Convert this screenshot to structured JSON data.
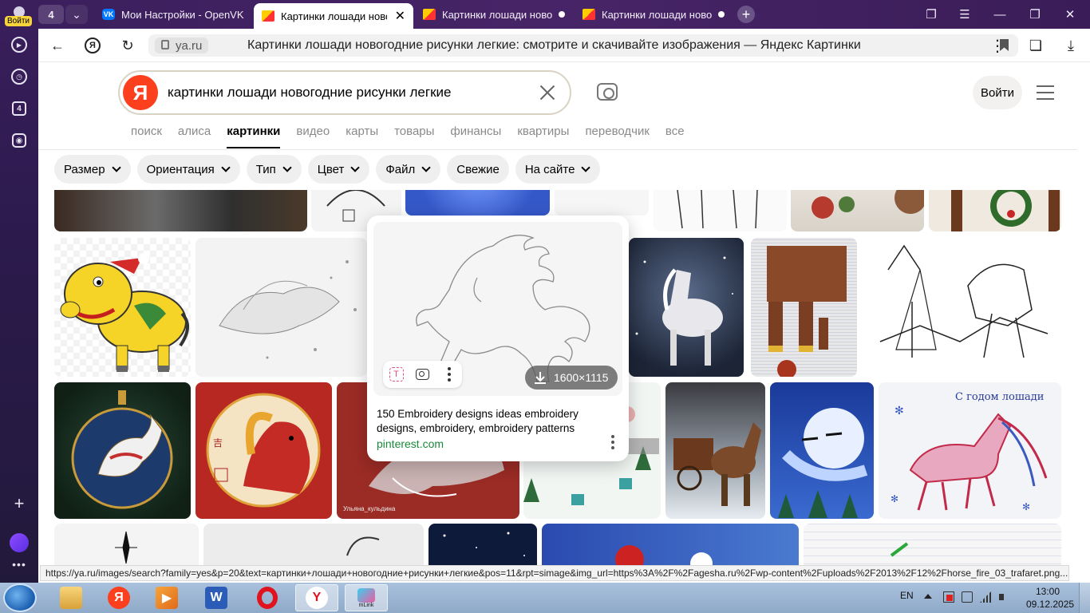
{
  "sidebar": {
    "login_badge": "Войти",
    "tabs_count": "4"
  },
  "tabbar": {
    "tab_count": "4",
    "tabs": [
      {
        "title": "Мои Настройки - OpenVK"
      },
      {
        "title": "Картинки лошади новогодние рисунки легкие"
      },
      {
        "title": "Картинки лошади новогодние рисунки легкие"
      },
      {
        "title": "Картинки лошади новогодние рисунки легкие"
      }
    ]
  },
  "addressbar": {
    "domain": "ya.ru",
    "page_title": "Картинки лошади новогодние рисунки легкие: смотрите и скачивайте изображения — Яндекс Картинки"
  },
  "search": {
    "logo": "Я",
    "query": "картинки лошади новогодние рисунки легкие",
    "login_label": "Войти"
  },
  "services": [
    "поиск",
    "алиса",
    "картинки",
    "видео",
    "карты",
    "товары",
    "финансы",
    "квартиры",
    "переводчик",
    "все"
  ],
  "active_service": "картинки",
  "filters": [
    {
      "label": "Размер",
      "dropdown": true
    },
    {
      "label": "Ориентация",
      "dropdown": true
    },
    {
      "label": "Тип",
      "dropdown": true
    },
    {
      "label": "Цвет",
      "dropdown": true
    },
    {
      "label": "Файл",
      "dropdown": true
    },
    {
      "label": "Свежие",
      "dropdown": false
    },
    {
      "label": "На сайте",
      "dropdown": true
    }
  ],
  "popup": {
    "resolution": "1600×1115",
    "title": "150 Embroidery designs ideas embroidery designs, embroidery, embroidery patterns",
    "source": "pinterest.com"
  },
  "tile_texts": {
    "greeting": "С годом лошади",
    "watermark": "Ульяна_кульдина"
  },
  "status_url": "https://ya.ru/images/search?family=yes&p=20&text=картинки+лошади+новогодние+рисунки+легкие&pos=11&rpt=simage&img_url=https%3A%2F%2Fagesha.ru%2Fwp-content%2Fuploads%2F2013%2F12%2Fhorse_fire_03_trafaret.png...",
  "taskbar": {
    "lang": "EN",
    "time": "13:00",
    "date": "09.12.2025",
    "mlink_label": "mLink"
  },
  "colors": {
    "accent_red": "#fc3f1d",
    "source_green": "#198a3a",
    "sidebar_purple": "#3a1f5c"
  }
}
